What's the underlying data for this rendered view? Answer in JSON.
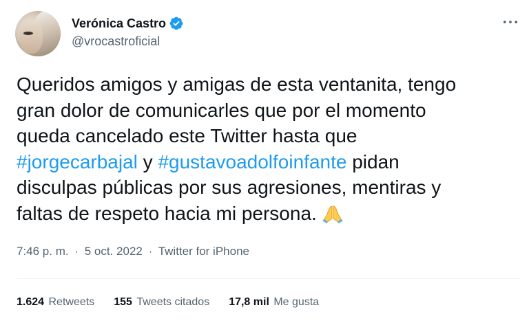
{
  "author": {
    "display_name": "Verónica Castro",
    "handle": "@vrocastroficial",
    "verified": true,
    "verified_color": "#1d9bf0"
  },
  "tweet": {
    "line1": "Queridos amigos y amigas de esta ventanita, tengo",
    "line2": "gran dolor de comunicarles que por el momento",
    "line3": "queda cancelado este Twitter hasta que",
    "hashtag1": "#jorgecarbajal",
    "connector": " y ",
    "hashtag2": "#gustavoadolfoinfante",
    "line4_tail": " pidan",
    "line5": "disculpas públicas por sus agresiones, mentiras y",
    "line6": "faltas de respeto hacia mi persona.",
    "emoji": "folded-hands-emoji"
  },
  "meta": {
    "time": "7:46 p. m.",
    "separator1": "·",
    "date": "5 oct. 2022",
    "separator2": "·",
    "source": "Twitter for iPhone"
  },
  "stats": {
    "retweets_count": "1.624",
    "retweets_label": "Retweets",
    "quotes_count": "155",
    "quotes_label": "Tweets citados",
    "likes_count": "17,8 mil",
    "likes_label": "Me gusta"
  },
  "colors": {
    "text": "#0f1419",
    "secondary": "#536471",
    "link": "#1d9bf0",
    "divider": "#eff3f4"
  },
  "icons": {
    "more": "more-horizontal-icon",
    "verified": "verified-badge-icon"
  }
}
